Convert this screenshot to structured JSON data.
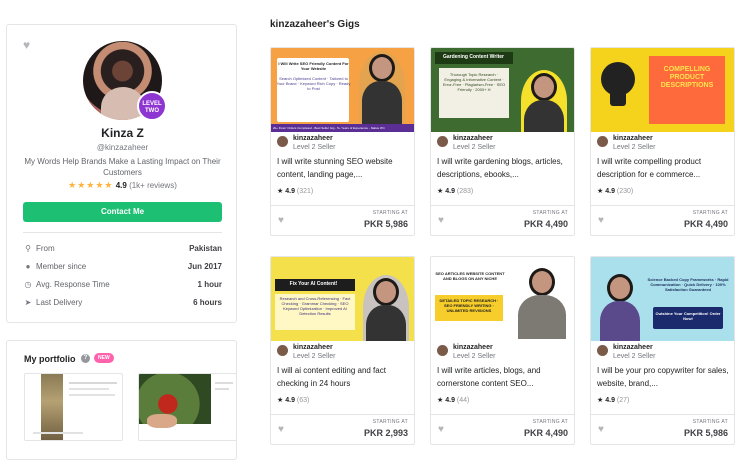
{
  "profile": {
    "name": "Kinza Z",
    "username": "@kinzazaheer",
    "level_badge_line1": "LEVEL",
    "level_badge_line2": "TWO",
    "tagline": "My Words Help Brands Make a Lasting Impact on Their Customers",
    "rating": "4.9",
    "reviews": "(1k+ reviews)",
    "contact_label": "Contact Me",
    "info": [
      {
        "icon": "location-pin-icon",
        "label": "From",
        "value": "Pakistan"
      },
      {
        "icon": "person-icon",
        "label": "Member since",
        "value": "Jun 2017"
      },
      {
        "icon": "clock-icon",
        "label": "Avg. Response Time",
        "value": "1 hour"
      },
      {
        "icon": "send-icon",
        "label": "Last Delivery",
        "value": "6 hours"
      }
    ]
  },
  "portfolio": {
    "title": "My portfolio",
    "badge": "NEW"
  },
  "gigs": {
    "heading": "kinzazaheer's Gigs",
    "starting_label": "STARTING AT",
    "items": [
      {
        "seller": "kinzazaheer",
        "level": "Level 2 Seller",
        "title": "I will write stunning SEO website content, landing page,...",
        "rating": "4.9",
        "count": "(321)",
        "price": "PKR 5,986",
        "banner_title": "I Will Write SEO Friendly Content For Your Website",
        "banner_lines": "Search Optimized Content · Tailored to Your Brand · Keyword Rich Copy · Ready to Post",
        "banner_footer": "2k+ Fiverr Orders Completed - Best Seller Gig - 5+ Years of Experience - Native Wri",
        "bg": "#f7a145"
      },
      {
        "seller": "kinzazaheer",
        "level": "Level 2 Seller",
        "title": "I will write gardening blogs, articles, descriptions, ebooks,...",
        "rating": "4.9",
        "count": "(283)",
        "price": "PKR 4,490",
        "banner_title": "Gardening Content Writer",
        "banner_lines": "Thorough Topic Research · Engaging & Informative Content · Error-Free · Plagiarism-Free · SEO Friendly · 2000+ H",
        "banner_footer": "",
        "bg": "#3e6b2f"
      },
      {
        "seller": "kinzazaheer",
        "level": "Level 2 Seller",
        "title": "I will write compelling product description for e commerce...",
        "rating": "4.9",
        "count": "(230)",
        "price": "PKR 4,490",
        "banner_title": "COMPELLING PRODUCT DESCRIPTIONS",
        "banner_lines": "",
        "banner_footer": "",
        "bg": "#f5d21c"
      },
      {
        "seller": "kinzazaheer",
        "level": "Level 2 Seller",
        "title": "I will ai content editing and fact checking in 24 hours",
        "rating": "4.9",
        "count": "(63)",
        "price": "PKR 2,993",
        "banner_title": "Fix Your AI Content!",
        "banner_lines": "Research and Cross-Referencing · Fact Checking · Grammar Checking · SEO Keyword Optimization · Improved AI Detection Results",
        "banner_footer": "",
        "bg": "#f3e04a"
      },
      {
        "seller": "kinzazaheer",
        "level": "Level 2 Seller",
        "title": "I will write articles, blogs, and cornerstone content SEO...",
        "rating": "4.9",
        "count": "(44)",
        "price": "PKR 4,490",
        "banner_title": "SEO ARTICLES WEBSITE CONTENT AND BLOGS ON ANY NICHE",
        "banner_lines": "DETAILED TOPIC RESEARCH · SEO FRIENDLY WRITING · UNLIMITED REVISIONS",
        "banner_footer": "",
        "bg": "#ffffff"
      },
      {
        "seller": "kinzazaheer",
        "level": "Level 2 Seller",
        "title": "I will be your pro copywriter for sales, website, brand,...",
        "rating": "4.9",
        "count": "(27)",
        "price": "PKR 5,986",
        "banner_title": "Science Backed Copy Frameworks · Rapid Communication · Quick Delivery · 100% Satisfaction Guaranteed",
        "banner_lines": "Outshine Your Competition! Order Now!",
        "banner_footer": "",
        "bg": "#a9e0ec"
      }
    ]
  }
}
